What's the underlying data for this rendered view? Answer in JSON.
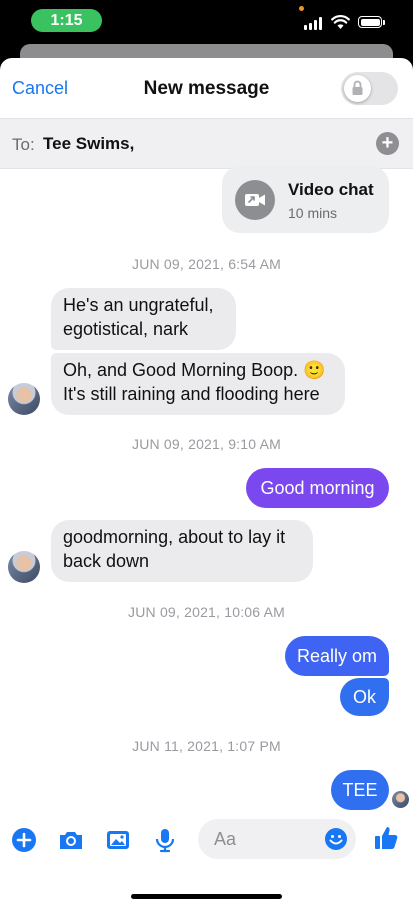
{
  "status_bar": {
    "time": "1:15"
  },
  "header": {
    "cancel_label": "Cancel",
    "title": "New message"
  },
  "recipient": {
    "to_label": "To:",
    "name": "Tee Swims,"
  },
  "video_chat": {
    "title": "Video chat",
    "duration": "10 mins"
  },
  "timestamps": [
    "JUN 09, 2021, 6:54 AM",
    "JUN 09, 2021, 9:10 AM",
    "JUN 09, 2021, 10:06 AM",
    "JUN 11, 2021, 1:07 PM"
  ],
  "messages": [
    {
      "text": "He's an ungrateful, egotistical, nark",
      "direction": "in"
    },
    {
      "text": "Oh, and Good Morning Boop. 🙂 It's still raining and flooding here",
      "direction": "in"
    },
    {
      "text": "Good morning",
      "direction": "out"
    },
    {
      "text": "goodmorning, about to lay it back down",
      "direction": "in"
    },
    {
      "text": "Really om",
      "direction": "out"
    },
    {
      "text": "Ok",
      "direction": "out"
    },
    {
      "text": "TEE",
      "direction": "out"
    }
  ],
  "composer": {
    "placeholder": "Aa"
  },
  "colors": {
    "accent": "#1877f2",
    "bubble_purple": "#7b47ef",
    "bubble_blue": "#2f6ff0",
    "incoming_bubble": "#ebebed"
  },
  "icons": [
    "plus-circle-icon",
    "camera-icon",
    "image-icon",
    "microphone-icon",
    "emoji-icon",
    "thumbs-up-icon",
    "lock-icon",
    "video-camera-icon"
  ]
}
